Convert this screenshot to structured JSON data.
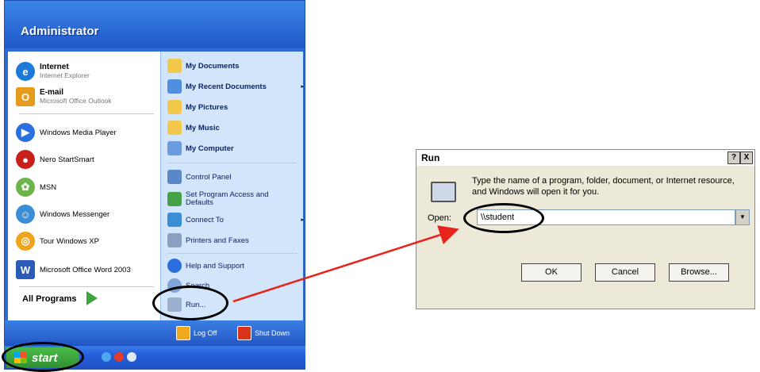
{
  "start_menu": {
    "user": "Administrator",
    "pinned": [
      {
        "title": "Internet",
        "subtitle": "Internet Explorer",
        "color": "#1d7ad8"
      },
      {
        "title": "E-mail",
        "subtitle": "Microsoft Office Outlook",
        "color": "#e69b1c"
      }
    ],
    "recent": [
      {
        "label": "Windows Media Player",
        "color": "#2a6ee0"
      },
      {
        "label": "Nero StartSmart",
        "color": "#c8201b"
      },
      {
        "label": "MSN",
        "color": "#6bb54a"
      },
      {
        "label": "Windows Messenger",
        "color": "#3a8ed6"
      },
      {
        "label": "Tour Windows XP",
        "color": "#f0a41c"
      },
      {
        "label": "Microsoft Office Word 2003",
        "color": "#2b5bb8"
      }
    ],
    "all_programs": "All Programs",
    "right": [
      {
        "label": "My Documents",
        "bold": true,
        "color": "#f2c94c"
      },
      {
        "label": "My Recent Documents",
        "bold": true,
        "arrow": "▸",
        "color": "#4f8fdc"
      },
      {
        "label": "My Pictures",
        "bold": true,
        "color": "#f2c94c"
      },
      {
        "label": "My Music",
        "bold": true,
        "color": "#f2c94c"
      },
      {
        "label": "My Computer",
        "bold": true,
        "color": "#6c9be0"
      },
      {
        "label": "Control Panel",
        "bold": false,
        "color": "#5a87c8"
      },
      {
        "label": "Set Program Access and Defaults",
        "bold": false,
        "color": "#46a246"
      },
      {
        "label": "Connect To",
        "bold": false,
        "arrow": "▸",
        "color": "#3a8ed6"
      },
      {
        "label": "Printers and Faxes",
        "bold": false,
        "color": "#8aa0c0"
      },
      {
        "label": "Help and Support",
        "bold": false,
        "color": "#2a6ee0"
      },
      {
        "label": "Search",
        "bold": false,
        "color": "#7fa6d8"
      },
      {
        "label": "Run...",
        "bold": false,
        "color": "#9ab0cf"
      }
    ],
    "log_off": "Log Off",
    "shut_down": "Shut Down"
  },
  "taskbar": {
    "start_label": "start"
  },
  "run_dialog": {
    "title": "Run",
    "help_btn": "?",
    "close_btn": "X",
    "description": "Type the name of a program, folder, document, or Internet resource, and Windows will open it for you.",
    "open_label": "Open:",
    "open_value": "\\\\student",
    "ok": "OK",
    "cancel": "Cancel",
    "browse": "Browse..."
  },
  "colors": {
    "annotation_arrow": "#e8231b"
  }
}
